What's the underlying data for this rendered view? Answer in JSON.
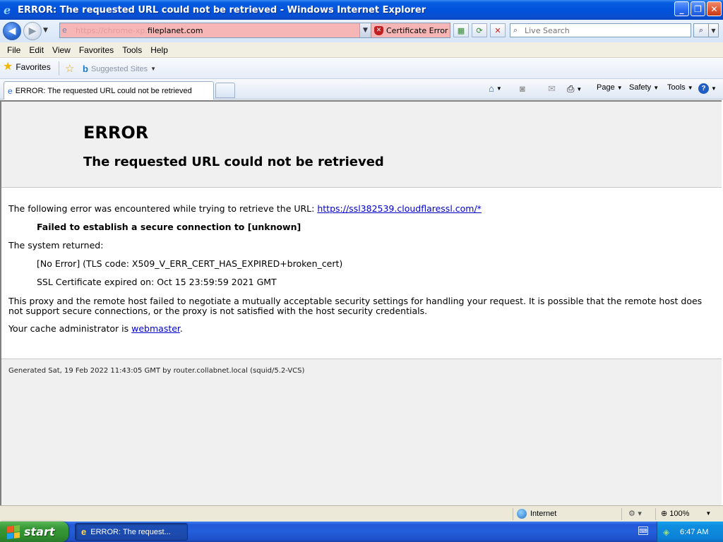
{
  "window": {
    "title": "ERROR: The requested URL could not be retrieved - Windows Internet Explorer",
    "buttons": {
      "minimize": "_",
      "maximize": "❐",
      "close": "✕"
    }
  },
  "address_bar": {
    "url_faded": "https://chrome-xp.",
    "url_domain": "fileplanet.com",
    "cert_error_label": "Certificate Error",
    "search_placeholder": "Live Search"
  },
  "menu": [
    "File",
    "Edit",
    "View",
    "Favorites",
    "Tools",
    "Help"
  ],
  "favorites_bar": {
    "favorites_label": "Favorites",
    "suggested_sites_label": "Suggested Sites"
  },
  "tabs": {
    "active_title": "ERROR: The requested URL could not be retrieved"
  },
  "command_bar": {
    "page_label": "Page",
    "safety_label": "Safety",
    "tools_label": "Tools"
  },
  "page": {
    "heading": "ERROR",
    "subheading": "The requested URL could not be retrieved",
    "intro_text": "The following error was encountered while trying to retrieve the URL:",
    "intro_link": "https://ssl382539.cloudflaressl.com/*",
    "error_title": "Failed to establish a secure connection to [unknown]",
    "system_returned": "The system returned:",
    "tls_code": "[No Error] (TLS code: X509_V_ERR_CERT_HAS_EXPIRED+broken_cert)",
    "cert_expired": "SSL Certificate expired on: Oct 15 23:59:59 2021 GMT",
    "description": "This proxy and the remote host failed to negotiate a mutually acceptable security settings for handling your request. It is possible that the remote host does not support secure connections, or the proxy is not satisfied with the host security credentials.",
    "admin_text": "Your cache administrator is",
    "admin_link": "webmaster",
    "admin_end": ".",
    "footer": "Generated Sat, 19 Feb 2022 11:43:05 GMT by router.collabnet.local (squid/5.2-VCS)"
  },
  "status_bar": {
    "zone": "Internet",
    "zoom": "100%"
  },
  "taskbar": {
    "start_label": "start",
    "task_title": "ERROR: The request...",
    "clock": "6:47 AM"
  },
  "colors": {
    "url_error_bg": "#f7b6b6",
    "link": "#0000cc",
    "titlebar": "#0052dc",
    "start_green": "#3a9a3a"
  }
}
